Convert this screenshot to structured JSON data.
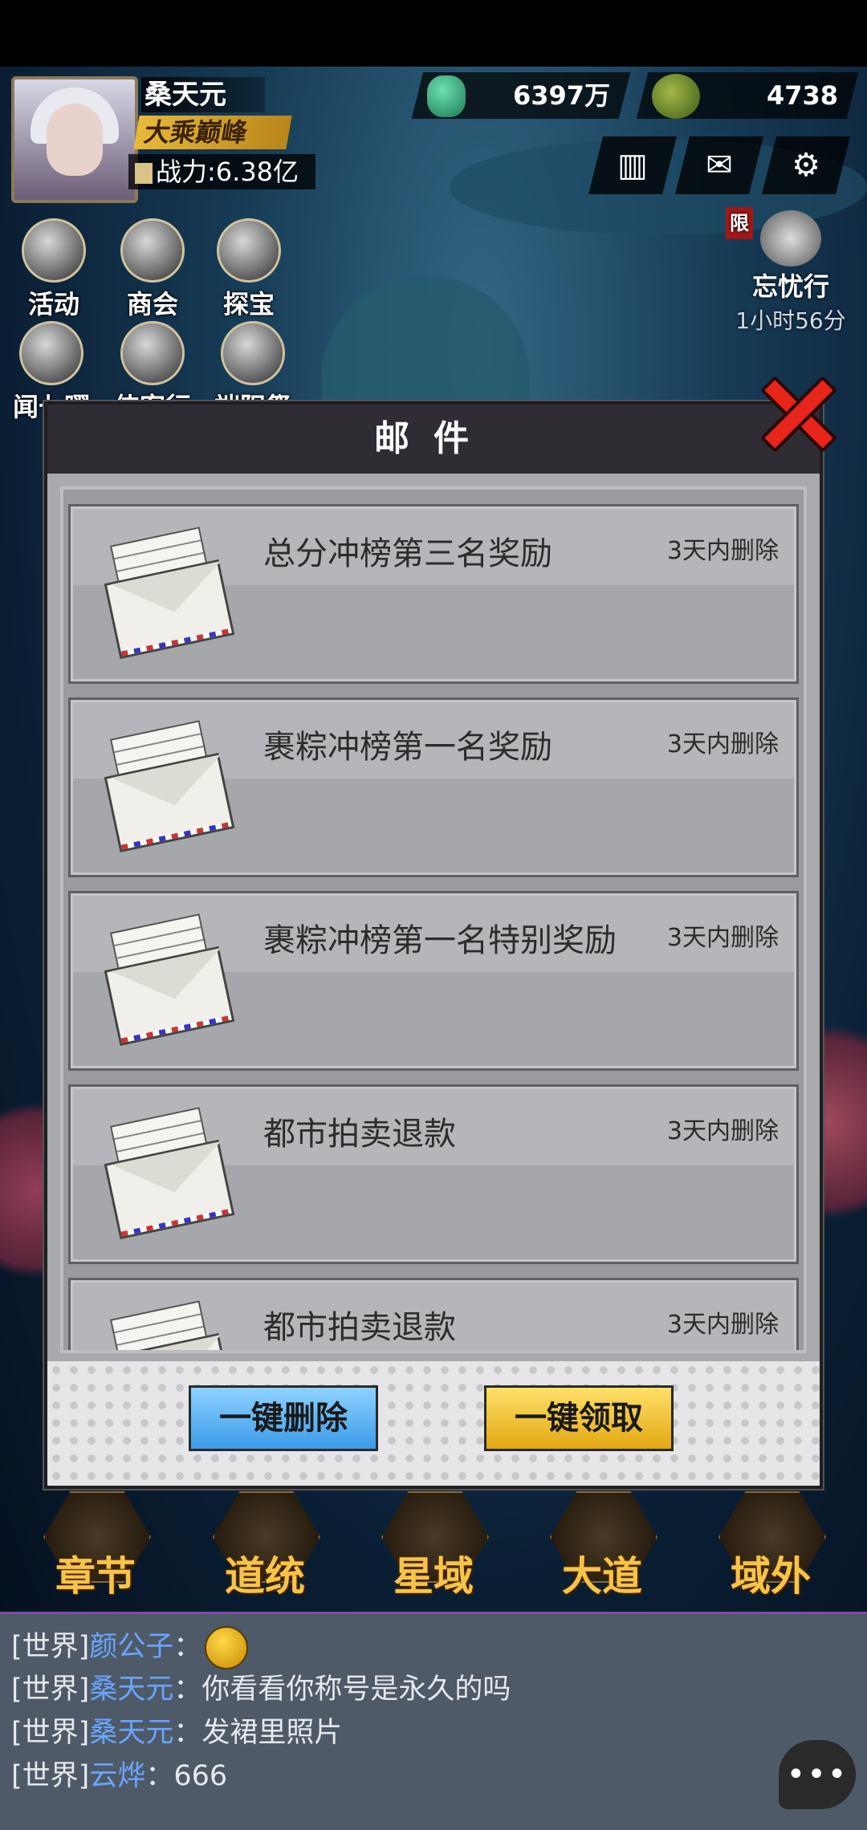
{
  "player": {
    "name": "桑天元",
    "rank": "大乘巅峰",
    "power": "战力:6.38亿"
  },
  "resources": {
    "jade": "6397万",
    "snake": "4738"
  },
  "top_buttons": [
    "ranking-icon",
    "mail-icon",
    "gear-icon"
  ],
  "menu": {
    "activity": "活动",
    "guild": "商会",
    "treasure": "探宝",
    "wen": "闻七曜",
    "xia": "侠客行",
    "duanyang": "端阳祭"
  },
  "wangyou": {
    "badge": "限",
    "label": "忘忧行",
    "timer": "1小时56分"
  },
  "modal": {
    "title": "邮件",
    "mails": [
      {
        "title": "总分冲榜第三名奖励",
        "expire": "3天内删除"
      },
      {
        "title": "裹粽冲榜第一名奖励",
        "expire": "3天内删除"
      },
      {
        "title": "裹粽冲榜第一名特别奖励",
        "expire": "3天内删除"
      },
      {
        "title": "都市拍卖退款",
        "expire": "3天内删除"
      },
      {
        "title": "都市拍卖退款",
        "expire": "3天内删除"
      }
    ],
    "delete_all": "一键删除",
    "claim_all": "一键领取"
  },
  "nav": [
    "章节",
    "道统",
    "星域",
    "大道",
    "域外"
  ],
  "chat": [
    {
      "channel": "[世界]",
      "name": "颜公子",
      "sep": "：",
      "text": ""
    },
    {
      "channel": "[世界]",
      "name": "桑天元",
      "sep": "：",
      "text": "你看看你称号是永久的吗"
    },
    {
      "channel": "[世界]",
      "name": "桑天元",
      "sep": "：",
      "text": "发裙里照片"
    },
    {
      "channel": "[世界]",
      "name": "云烨",
      "sep": "：",
      "text": "666"
    }
  ],
  "chat_button": "•••"
}
